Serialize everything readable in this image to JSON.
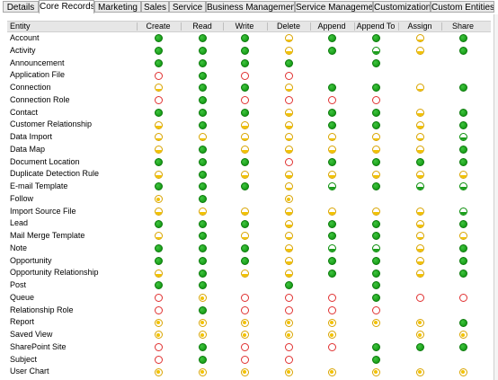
{
  "tabs": [
    {
      "label": "Details",
      "active": false
    },
    {
      "label": "Core Records",
      "active": true
    },
    {
      "label": "Marketing",
      "active": false
    },
    {
      "label": "Sales",
      "active": false
    },
    {
      "label": "Service",
      "active": false
    },
    {
      "label": "Business Management",
      "active": false
    },
    {
      "label": "Service Management",
      "active": false
    },
    {
      "label": "Customization",
      "active": false
    },
    {
      "label": "Custom Entities",
      "active": false
    }
  ],
  "grid": {
    "entity_header": "Entity",
    "columns": [
      "Create",
      "Read",
      "Write",
      "Delete",
      "Append",
      "Append To",
      "Assign",
      "Share"
    ],
    "legend_codes": {
      "O": "organization",
      "B": "business-unit",
      "U": "user",
      "b": "basic",
      "N": "none",
      "-": "not-applicable"
    },
    "rows": [
      {
        "entity": "Account",
        "levels": [
          "O",
          "O",
          "O",
          "U",
          "O",
          "O",
          "U",
          "O"
        ]
      },
      {
        "entity": "Activity",
        "levels": [
          "O",
          "O",
          "O",
          "U",
          "O",
          "B",
          "U",
          "O"
        ]
      },
      {
        "entity": "Announcement",
        "levels": [
          "O",
          "O",
          "O",
          "O",
          "-",
          "O",
          "-",
          "-"
        ]
      },
      {
        "entity": "Application File",
        "levels": [
          "N",
          "O",
          "N",
          "N",
          "-",
          "-",
          "-",
          "-"
        ]
      },
      {
        "entity": "Connection",
        "levels": [
          "U",
          "O",
          "O",
          "U",
          "O",
          "O",
          "U",
          "O"
        ]
      },
      {
        "entity": "Connection Role",
        "levels": [
          "N",
          "O",
          "N",
          "N",
          "N",
          "N",
          "-",
          "-"
        ]
      },
      {
        "entity": "Contact",
        "levels": [
          "O",
          "O",
          "O",
          "U",
          "O",
          "O",
          "U",
          "O"
        ]
      },
      {
        "entity": "Customer Relationship",
        "levels": [
          "U",
          "O",
          "U",
          "U",
          "O",
          "O",
          "U",
          "O"
        ]
      },
      {
        "entity": "Data Import",
        "levels": [
          "U",
          "U",
          "U",
          "U",
          "U",
          "U",
          "U",
          "B"
        ]
      },
      {
        "entity": "Data Map",
        "levels": [
          "U",
          "O",
          "U",
          "U",
          "U",
          "U",
          "U",
          "O"
        ]
      },
      {
        "entity": "Document Location",
        "levels": [
          "O",
          "O",
          "O",
          "N",
          "O",
          "O",
          "O",
          "O"
        ]
      },
      {
        "entity": "Duplicate Detection Rule",
        "levels": [
          "U",
          "O",
          "U",
          "U",
          "U",
          "U",
          "U",
          "U"
        ]
      },
      {
        "entity": "E-mail Template",
        "levels": [
          "O",
          "O",
          "O",
          "U",
          "B",
          "O",
          "B",
          "B"
        ]
      },
      {
        "entity": "Follow",
        "levels": [
          "b",
          "O",
          "-",
          "b",
          "-",
          "-",
          "-",
          "-"
        ]
      },
      {
        "entity": "Import Source File",
        "levels": [
          "U",
          "U",
          "U",
          "U",
          "U",
          "U",
          "U",
          "B"
        ]
      },
      {
        "entity": "Lead",
        "levels": [
          "O",
          "O",
          "O",
          "U",
          "O",
          "O",
          "U",
          "O"
        ]
      },
      {
        "entity": "Mail Merge Template",
        "levels": [
          "U",
          "O",
          "U",
          "U",
          "O",
          "O",
          "U",
          "U"
        ]
      },
      {
        "entity": "Note",
        "levels": [
          "O",
          "O",
          "O",
          "U",
          "B",
          "B",
          "U",
          "O"
        ]
      },
      {
        "entity": "Opportunity",
        "levels": [
          "O",
          "O",
          "O",
          "U",
          "O",
          "O",
          "U",
          "O"
        ]
      },
      {
        "entity": "Opportunity Relationship",
        "levels": [
          "U",
          "O",
          "U",
          "U",
          "O",
          "O",
          "U",
          "O"
        ]
      },
      {
        "entity": "Post",
        "levels": [
          "O",
          "O",
          "-",
          "O",
          "-",
          "O",
          "-",
          "-"
        ]
      },
      {
        "entity": "Queue",
        "levels": [
          "N",
          "b",
          "N",
          "N",
          "N",
          "O",
          "N",
          "N"
        ]
      },
      {
        "entity": "Relationship Role",
        "levels": [
          "N",
          "O",
          "N",
          "N",
          "N",
          "N",
          "-",
          "-"
        ]
      },
      {
        "entity": "Report",
        "levels": [
          "b",
          "b",
          "b",
          "b",
          "b",
          "b",
          "b",
          "O"
        ]
      },
      {
        "entity": "Saved View",
        "levels": [
          "b",
          "b",
          "b",
          "b",
          "b",
          "-",
          "b",
          "b"
        ]
      },
      {
        "entity": "SharePoint Site",
        "levels": [
          "N",
          "O",
          "N",
          "N",
          "N",
          "O",
          "O",
          "O"
        ]
      },
      {
        "entity": "Subject",
        "levels": [
          "N",
          "O",
          "N",
          "N",
          "-",
          "O",
          "-",
          "-"
        ]
      },
      {
        "entity": "User Chart",
        "levels": [
          "b",
          "b",
          "b",
          "b",
          "b",
          "b",
          "b",
          "b"
        ]
      }
    ]
  }
}
